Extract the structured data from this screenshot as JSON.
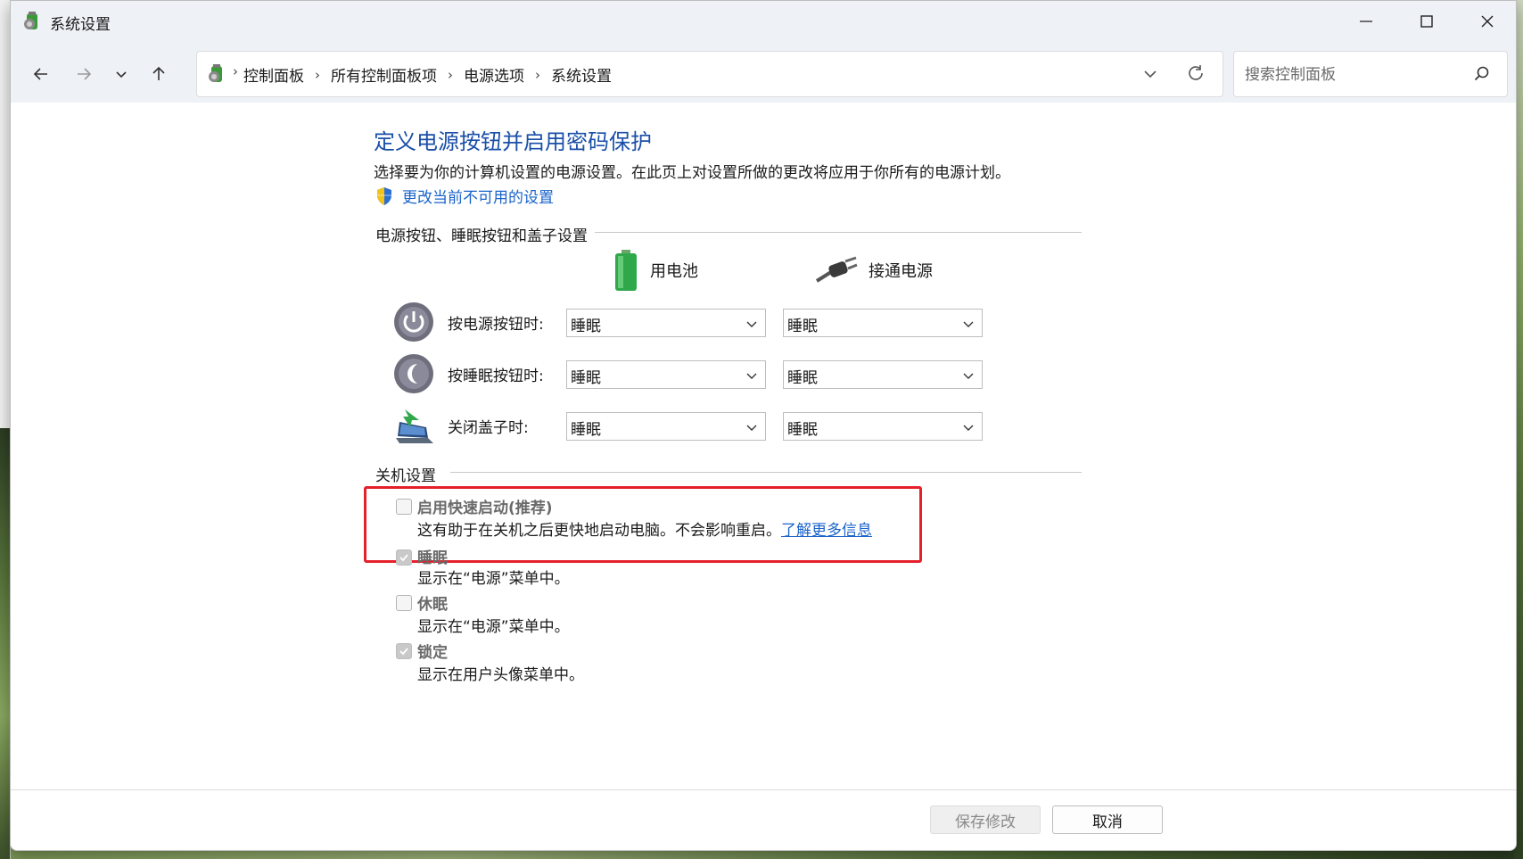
{
  "window": {
    "title": "系统设置",
    "accent": "#1a4fa8"
  },
  "nav": {
    "breadcrumb": [
      "控制面板",
      "所有控制面板项",
      "电源选项",
      "系统设置"
    ],
    "search_placeholder": "搜索控制面板"
  },
  "page": {
    "heading": "定义电源按钮并启用密码保护",
    "description": "选择要为你的计算机设置的电源设置。在此页上对设置所做的更改将应用于你所有的电源计划。",
    "admin_link": "更改当前不可用的设置"
  },
  "buttons_section": {
    "title": "电源按钮、睡眠按钮和盖子设置",
    "col_battery": "用电池",
    "col_plugged": "接通电源",
    "rows": [
      {
        "label": "按电源按钮时:",
        "battery": "睡眠",
        "plugged": "睡眠",
        "icon": "power-button-icon"
      },
      {
        "label": "按睡眠按钮时:",
        "battery": "睡眠",
        "plugged": "睡眠",
        "icon": "sleep-button-icon"
      },
      {
        "label": "关闭盖子时:",
        "battery": "睡眠",
        "plugged": "睡眠",
        "icon": "laptop-lid-icon"
      }
    ]
  },
  "shutdown_section": {
    "title": "关机设置",
    "options": [
      {
        "title": "启用快速启动(推荐)",
        "desc": "这有助于在关机之后更快地启动电脑。不会影响重启。",
        "link": "了解更多信息",
        "checked": false
      },
      {
        "title": "睡眠",
        "desc": "显示在“电源”菜单中。",
        "checked": true
      },
      {
        "title": "休眠",
        "desc": "显示在“电源”菜单中。",
        "checked": false
      },
      {
        "title": "锁定",
        "desc": "显示在用户头像菜单中。",
        "checked": true
      }
    ]
  },
  "footer": {
    "save_label": "保存修改",
    "cancel_label": "取消"
  }
}
